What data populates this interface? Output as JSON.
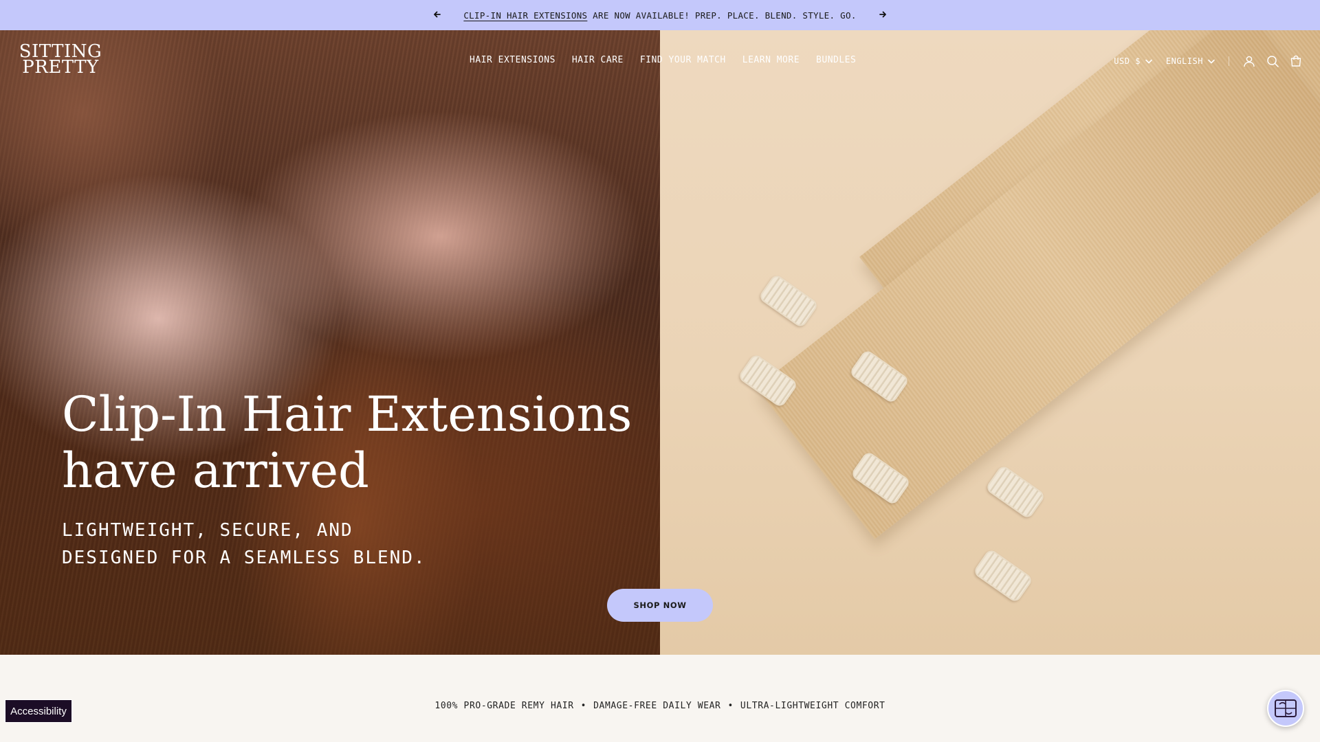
{
  "announcement": {
    "link_text": "CLIP-IN HAIR EXTENSIONS",
    "rest_text": " ARE NOW AVAILABLE! PREP. PLACE. BLEND. STYLE. GO.",
    "prev_icon": "arrow-left-icon",
    "next_icon": "arrow-right-icon"
  },
  "header": {
    "logo_line1": "SITTING",
    "logo_line2": "PRETTY",
    "nav": [
      {
        "label": "HAIR EXTENSIONS"
      },
      {
        "label": "HAIR CARE"
      },
      {
        "label": "FIND YOUR MATCH"
      },
      {
        "label": "LEARN MORE"
      },
      {
        "label": "BUNDLES"
      }
    ],
    "currency": "USD $",
    "language": "ENGLISH",
    "icons": [
      "account-icon",
      "search-icon",
      "cart-icon"
    ]
  },
  "hero": {
    "title_line1": "Clip-In Hair Extensions",
    "title_line2": "have arrived",
    "subtitle_line1": "LIGHTWEIGHT, SECURE, AND",
    "subtitle_line2": "DESIGNED FOR A SEAMLESS BLEND.",
    "cta_label": "SHOP NOW"
  },
  "features": {
    "items": [
      "100% PRO-GRADE REMY HAIR",
      "DAMAGE-FREE DAILY WEAR",
      "ULTRA-LIGHTWEIGHT COMFORT"
    ],
    "separator": "•"
  },
  "accessibility_label": "Accessibility",
  "chat_icon": "chat-widget-icon",
  "colors": {
    "accent": "#c4c8fb",
    "page_background": "#f8f5f1",
    "accessibility_bg": "#1c0d26"
  }
}
